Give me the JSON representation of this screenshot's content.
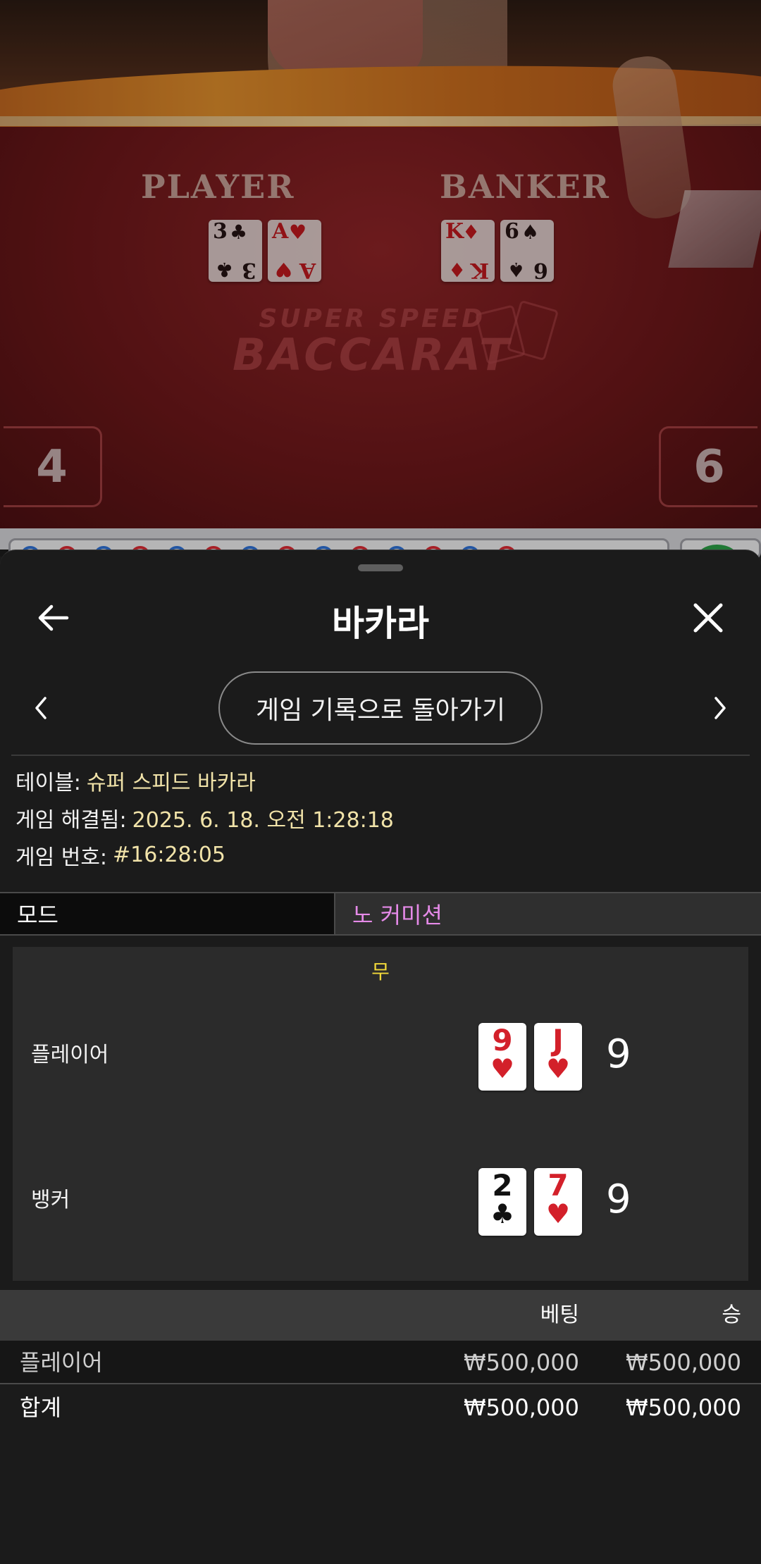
{
  "video": {
    "player_label": "PLAYER",
    "banker_label": "BANKER",
    "player_cards": [
      {
        "rank": "3",
        "suit": "♣",
        "color": "black"
      },
      {
        "rank": "A",
        "suit": "♥",
        "color": "red"
      }
    ],
    "banker_cards": [
      {
        "rank": "K",
        "suit": "♦",
        "color": "red"
      },
      {
        "rank": "6",
        "suit": "♠",
        "color": "black"
      }
    ],
    "logo_line1": "SUPER SPEED",
    "logo_line2": "BACCARAT",
    "player_score": "4",
    "banker_score": "6"
  },
  "sheet": {
    "title": "바카라",
    "back_icon": "arrow-left-icon",
    "close_icon": "close-icon",
    "history_button": "게임 기록으로 돌아가기",
    "prev_icon": "chevron-left-icon",
    "next_icon": "chevron-right-icon"
  },
  "info": {
    "table_label": "테이블:",
    "table_value": "슈퍼 스피드 바카라",
    "resolved_label": "게임 해결됨:",
    "resolved_value": "2025. 6. 18. 오전 1:28:18",
    "number_label": "게임 번호:",
    "number_value": "#16:28:05"
  },
  "mode": {
    "label": "모드",
    "value": "노 커미션"
  },
  "result": {
    "outcome": "무",
    "player": {
      "label": "플레이어",
      "cards": [
        {
          "rank": "9",
          "suit": "♥",
          "color": "red"
        },
        {
          "rank": "J",
          "suit": "♥",
          "color": "red"
        }
      ],
      "total": "9"
    },
    "banker": {
      "label": "뱅커",
      "cards": [
        {
          "rank": "2",
          "suit": "♣",
          "color": "black"
        },
        {
          "rank": "7",
          "suit": "♥",
          "color": "red"
        }
      ],
      "total": "9"
    }
  },
  "bets": {
    "col_bet": "베팅",
    "col_win": "승",
    "rows": [
      {
        "name": "플레이어",
        "bet": "₩500,000",
        "win": "₩500,000"
      }
    ],
    "total": {
      "name": "합계",
      "bet": "₩500,000",
      "win": "₩500,000"
    }
  },
  "colors": {
    "accent_yellow": "#f1e3a9",
    "outcome_yellow": "#f1d83a",
    "mode_pink": "#e58ae8",
    "card_red": "#d3202a"
  }
}
